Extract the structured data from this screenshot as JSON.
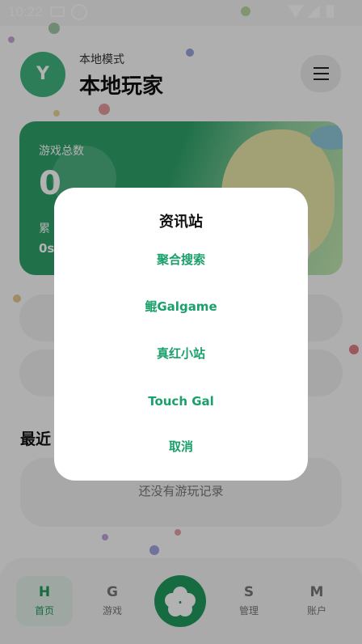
{
  "status_bar": {
    "time": "10:22"
  },
  "header": {
    "avatar_letter": "Y",
    "mode_label": "本地模式",
    "username": "本地玩家"
  },
  "stats_card": {
    "total_label": "游戏总数",
    "total_value": "0",
    "sub_label": "累",
    "sub_value": "0s"
  },
  "recent": {
    "title": "最近",
    "empty_text": "还没有游玩记录"
  },
  "bottom_nav": {
    "items": [
      {
        "letter": "H",
        "label": "首页"
      },
      {
        "letter": "G",
        "label": "游戏"
      },
      {
        "letter": "S",
        "label": "管理"
      },
      {
        "letter": "M",
        "label": "账户"
      }
    ],
    "accent": "#219a5d"
  },
  "dialog": {
    "title": "资讯站",
    "options": [
      "聚合搜索",
      "鲲Galgame",
      "真红小站",
      "Touch Gal"
    ],
    "cancel": "取消",
    "accent": "#1aa06a"
  }
}
